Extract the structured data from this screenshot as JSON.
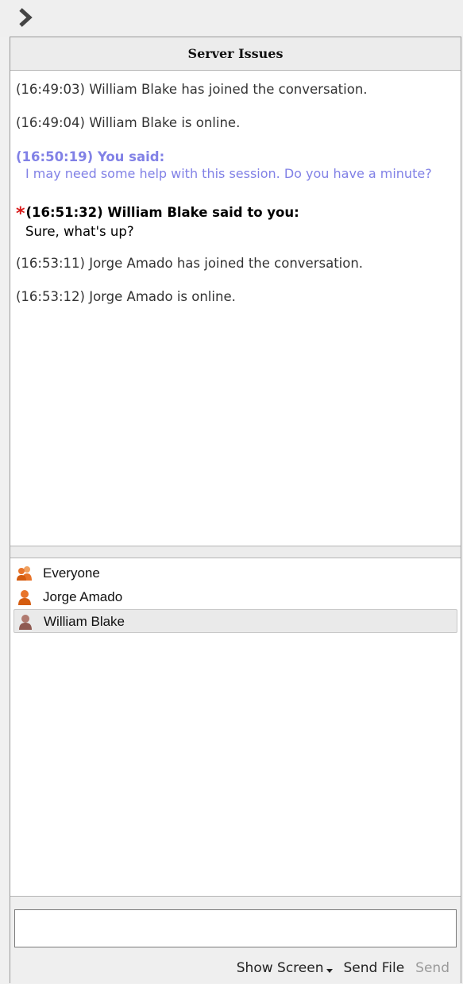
{
  "header": {
    "title": "Server Issues"
  },
  "transcript": {
    "messages": [
      {
        "text": "(16:49:03) William Blake has joined the conversation."
      },
      {
        "text": "(16:49:04) William Blake is online."
      },
      {
        "head": "(16:50:19) You said:",
        "body": "I may need some help with this session. Do you have a minute?"
      },
      {
        "marker": "*",
        "head": "(16:51:32) William Blake said to you:",
        "body": "Sure, what's up?"
      },
      {
        "text": "(16:53:11) Jorge Amado has joined the conversation."
      },
      {
        "text": "(16:53:12) Jorge Amado is online."
      }
    ]
  },
  "participants": {
    "items": [
      {
        "label": "Everyone",
        "icon": "group-icon",
        "color": "#e8742a"
      },
      {
        "label": "Jorge Amado",
        "icon": "user-icon",
        "color": "#e8742a"
      },
      {
        "label": "William Blake",
        "icon": "user-icon",
        "color": "#a0706a",
        "selected": true
      }
    ]
  },
  "composer": {
    "value": "",
    "placeholder": ""
  },
  "actions": {
    "show_screen": "Show Screen",
    "send_file": "Send File",
    "send": "Send"
  }
}
